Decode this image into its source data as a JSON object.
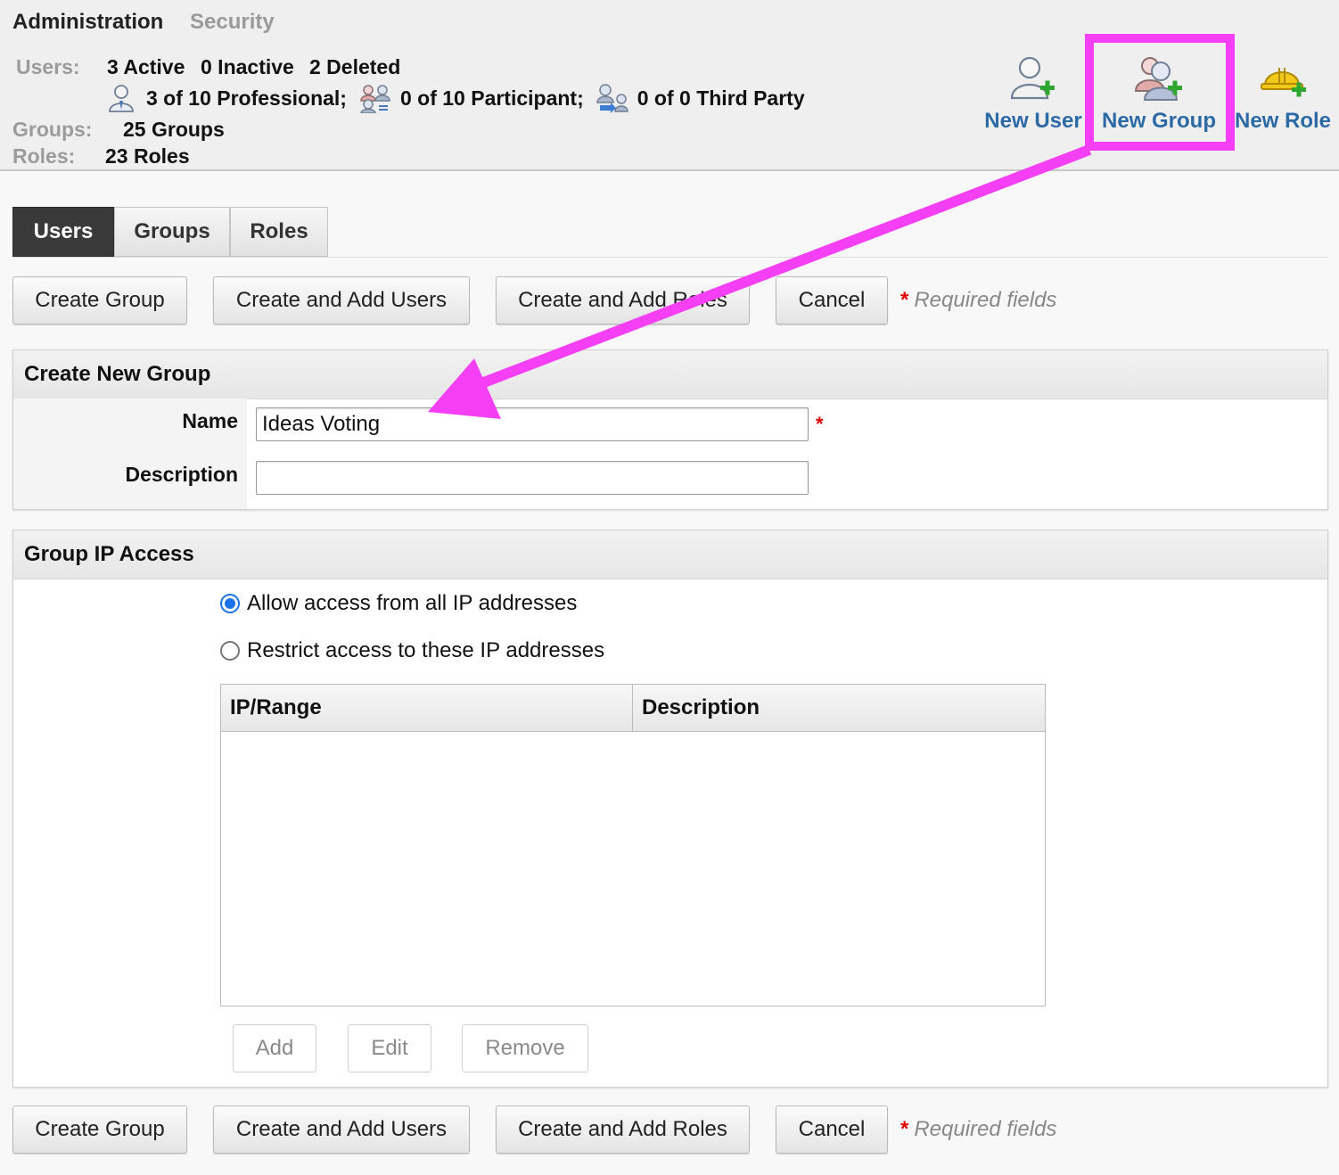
{
  "breadcrumb": {
    "active": "Administration",
    "inactive": "Security"
  },
  "summary": {
    "users_label": "Users:",
    "active": "3 Active",
    "inactive": "0 Inactive",
    "deleted": "2 Deleted",
    "licenses": [
      {
        "icon": "professional-user-icon",
        "text": "3 of 10 Professional;"
      },
      {
        "icon": "participant-user-icon",
        "text": "0 of 10 Participant;"
      },
      {
        "icon": "third-party-user-icon",
        "text": "0 of 0 Third Party"
      }
    ],
    "groups_label": "Groups:",
    "groups_value": "25 Groups",
    "roles_label": "Roles:",
    "roles_value": "23 Roles"
  },
  "actions": {
    "new_user": "New User",
    "new_group": "New Group",
    "new_role": "New Role"
  },
  "tabs": [
    {
      "label": "Users",
      "selected": true
    },
    {
      "label": "Groups",
      "selected": false
    },
    {
      "label": "Roles",
      "selected": false
    }
  ],
  "toolbar": {
    "create_group": "Create Group",
    "create_add_users": "Create and Add Users",
    "create_add_roles": "Create and Add Roles",
    "cancel": "Cancel",
    "required_star": "*",
    "required_text": "Required fields"
  },
  "create_group_panel": {
    "title": "Create New Group",
    "name_label": "Name",
    "name_value": "Ideas Voting",
    "description_label": "Description",
    "description_value": "",
    "required_star": "*"
  },
  "ip_access_panel": {
    "title": "Group IP Access",
    "options": [
      {
        "label": "Allow access from all IP addresses",
        "checked": true
      },
      {
        "label": "Restrict access to these IP addresses",
        "checked": false
      }
    ],
    "table_columns": [
      "IP/Range",
      "Description"
    ],
    "table_rows": [],
    "buttons": {
      "add": "Add",
      "edit": "Edit",
      "remove": "Remove"
    }
  },
  "annotation": {
    "highlight_color": "#f53ff5",
    "target": "New Group"
  },
  "colors": {
    "link_blue": "#2c6aa6",
    "radio_blue": "#1a73e8",
    "required_red": "#dd0000"
  }
}
